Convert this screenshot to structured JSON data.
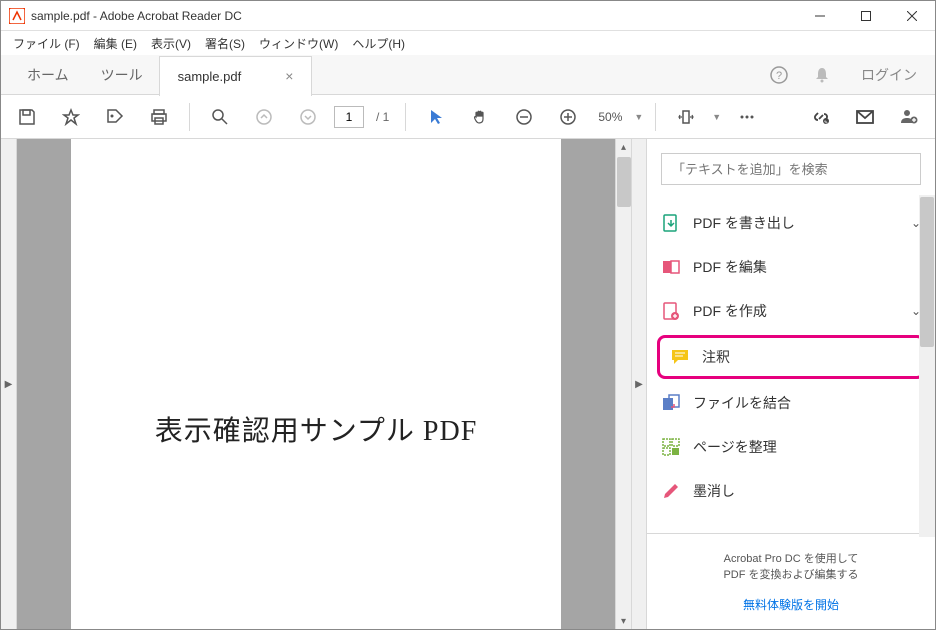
{
  "window": {
    "title": "sample.pdf - Adobe Acrobat Reader DC"
  },
  "menubar": {
    "file": "ファイル (F)",
    "edit": "編集 (E)",
    "view": "表示(V)",
    "sign": "署名(S)",
    "window": "ウィンドウ(W)",
    "help": "ヘルプ(H)"
  },
  "tabs": {
    "home": "ホーム",
    "tools": "ツール",
    "doc_title": "sample.pdf",
    "login": "ログイン"
  },
  "toolbar": {
    "page_current": "1",
    "page_total": "/ 1",
    "zoom": "50%"
  },
  "document": {
    "body_text": "表示確認用サンプル PDF"
  },
  "right_panel": {
    "search_placeholder": "「テキストを追加」を検索",
    "items": [
      {
        "label": "PDF を書き出し",
        "chev": true
      },
      {
        "label": "PDF を編集",
        "chev": false
      },
      {
        "label": "PDF を作成",
        "chev": true
      },
      {
        "label": "注釈",
        "chev": false
      },
      {
        "label": "ファイルを結合",
        "chev": false
      },
      {
        "label": "ページを整理",
        "chev": false
      },
      {
        "label": "墨消し",
        "chev": false
      }
    ],
    "footer_line1": "Acrobat Pro DC を使用して",
    "footer_line2": "PDF を変換および編集する",
    "footer_link": "無料体験版を開始"
  }
}
